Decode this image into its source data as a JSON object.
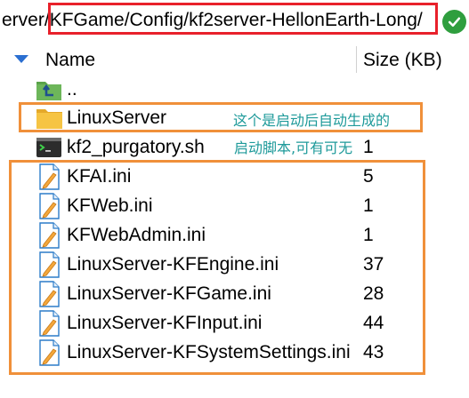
{
  "path_bar": {
    "prefix": "erver",
    "path": "/KFGame/Config/kf2server-HellonEarth-Long/",
    "confirm_icon": "checkmark-icon",
    "highlight_color": "#e8212b"
  },
  "columns": {
    "name": "Name",
    "size": "Size (KB)"
  },
  "rows": [
    {
      "name": "..",
      "size": "",
      "icon": "parent-folder-icon"
    },
    {
      "name": "LinuxServer",
      "size": "",
      "icon": "folder-icon"
    },
    {
      "name": "kf2_purgatory.sh",
      "size": "1",
      "icon": "terminal-script-icon"
    },
    {
      "name": "KFAI.ini",
      "size": "5",
      "icon": "ini-file-icon"
    },
    {
      "name": "KFWeb.ini",
      "size": "1",
      "icon": "ini-file-icon"
    },
    {
      "name": "KFWebAdmin.ini",
      "size": "1",
      "icon": "ini-file-icon"
    },
    {
      "name": "LinuxServer-KFEngine.ini",
      "size": "37",
      "icon": "ini-file-icon"
    },
    {
      "name": "LinuxServer-KFGame.ini",
      "size": "28",
      "icon": "ini-file-icon"
    },
    {
      "name": "LinuxServer-KFInput.ini",
      "size": "44",
      "icon": "ini-file-icon"
    },
    {
      "name": "LinuxServer-KFSystemSettings.ini",
      "size": "43",
      "icon": "ini-file-icon"
    }
  ],
  "annotations": {
    "folder_note": "这个是启动后自动生成的",
    "script_note": "启动脚本,可有可无",
    "box_color": "#f0903a",
    "note_color": "#1e9a9a"
  }
}
